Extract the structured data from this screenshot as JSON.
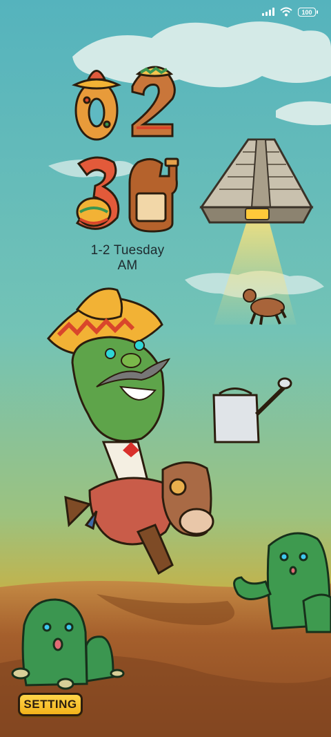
{
  "status_bar": {
    "battery": "100",
    "icons": [
      "signal-icon",
      "wifi-icon",
      "battery-icon"
    ]
  },
  "clock": {
    "hour": "02",
    "minute": "36"
  },
  "date_line": "1-2 Tuesday AM",
  "setting_button": {
    "label": "SETTING"
  },
  "colors": {
    "sky_top": "#6fbfc6",
    "sky_bottom": "#c9b24a",
    "ground": "#9a5a2a",
    "button": "#f4b71f"
  }
}
